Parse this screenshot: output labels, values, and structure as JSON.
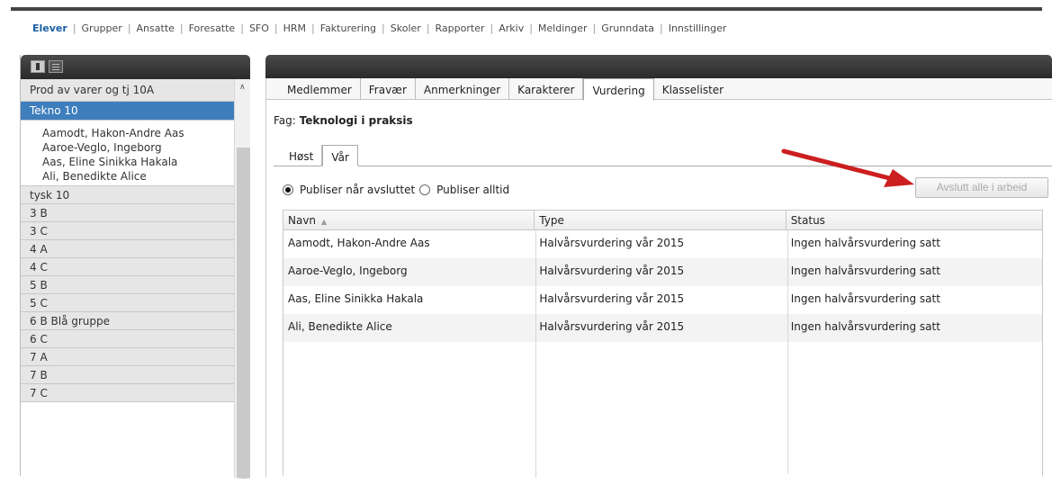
{
  "topnav": {
    "items": [
      {
        "label": "Elever",
        "active": true
      },
      {
        "label": "Grupper"
      },
      {
        "label": "Ansatte"
      },
      {
        "label": "Foresatte"
      },
      {
        "label": "SFO"
      },
      {
        "label": "HRM"
      },
      {
        "label": "Fakturering"
      },
      {
        "label": "Skoler"
      },
      {
        "label": "Rapporter"
      },
      {
        "label": "Arkiv"
      },
      {
        "label": "Meldinger"
      },
      {
        "label": "Grunndata"
      },
      {
        "label": "Innstillinger"
      }
    ]
  },
  "sidebar": {
    "groups": [
      {
        "label": "Prod av varer og tj 10A"
      },
      {
        "label": "Tekno 10",
        "selected": true
      },
      {
        "label": "tysk 10"
      },
      {
        "label": "3 B"
      },
      {
        "label": "3 C"
      },
      {
        "label": "4 A"
      },
      {
        "label": "4 C"
      },
      {
        "label": "5 B"
      },
      {
        "label": "5 C"
      },
      {
        "label": "6 B Blå gruppe"
      },
      {
        "label": "6 C"
      },
      {
        "label": "7 A"
      },
      {
        "label": "7 B"
      },
      {
        "label": "7 C"
      }
    ],
    "students": [
      "Aamodt, Hakon-Andre Aas",
      "Aaroe-Veglo, Ingeborg",
      "Aas, Eline Sinikka Hakala",
      "Ali, Benedikte Alice"
    ]
  },
  "main": {
    "tabs": [
      "Medlemmer",
      "Fravær",
      "Anmerkninger",
      "Karakterer",
      "Vurdering",
      "Klasselister"
    ],
    "active_tab": "Vurdering",
    "subject_prefix": "Fag:",
    "subject_name": "Teknologi i praksis",
    "subtabs": [
      "Høst",
      "Vår"
    ],
    "active_subtab": "Vår",
    "radio_publish_finished": "Publiser når avsluttet",
    "radio_publish_always": "Publiser alltid",
    "finish_button": "Avslutt alle i arbeid",
    "grid": {
      "headers": [
        "Navn",
        "Type",
        "Status"
      ],
      "rows": [
        [
          "Aamodt, Hakon-Andre Aas",
          "Halvårsvurdering vår 2015",
          "Ingen halvårsvurdering satt"
        ],
        [
          "Aaroe-Veglo, Ingeborg",
          "Halvårsvurdering vår 2015",
          "Ingen halvårsvurdering satt"
        ],
        [
          "Aas, Eline Sinikka Hakala",
          "Halvårsvurdering vår 2015",
          "Ingen halvårsvurdering satt"
        ],
        [
          "Ali, Benedikte Alice",
          "Halvårsvurdering vår 2015",
          "Ingen halvårsvurdering satt"
        ]
      ]
    }
  },
  "colors": {
    "accent": "#3f7ebd",
    "nav_active": "#1b5fa3",
    "annotation_arrow": "#cc1f1f"
  }
}
